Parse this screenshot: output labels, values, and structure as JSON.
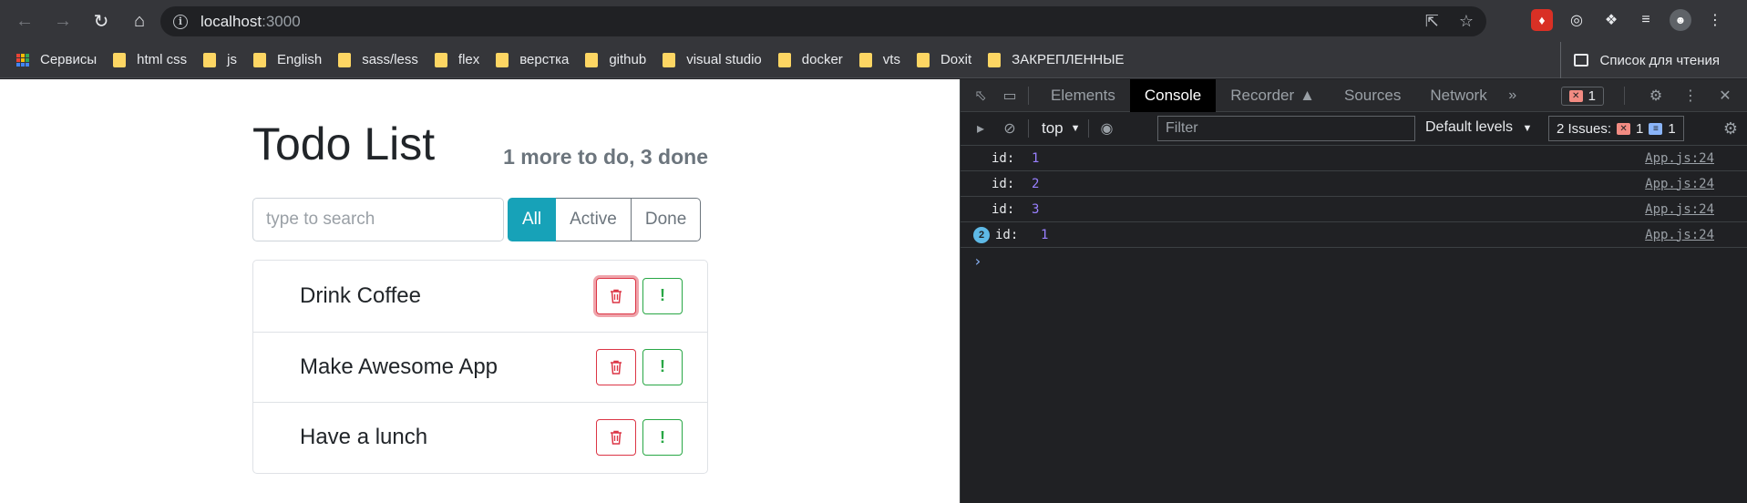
{
  "browser": {
    "url_host": "localhost",
    "url_port": ":3000",
    "bookmarks": [
      {
        "label": "Сервисы",
        "type": "apps"
      },
      {
        "label": "html css",
        "type": "folder"
      },
      {
        "label": "js",
        "type": "folder"
      },
      {
        "label": "English",
        "type": "folder"
      },
      {
        "label": "sass/less",
        "type": "folder"
      },
      {
        "label": "flex",
        "type": "folder"
      },
      {
        "label": "верстка",
        "type": "folder"
      },
      {
        "label": "github",
        "type": "folder"
      },
      {
        "label": "visual studio",
        "type": "folder"
      },
      {
        "label": "docker",
        "type": "folder"
      },
      {
        "label": "vts",
        "type": "folder"
      },
      {
        "label": "Doxit",
        "type": "folder"
      },
      {
        "label": "ЗАКРЕПЛЕННЫЕ",
        "type": "folder"
      }
    ],
    "reading_list": "Список для чтения"
  },
  "app": {
    "title": "Todo List",
    "status": "1 more to do, 3 done",
    "search_placeholder": "type to search",
    "filters": [
      {
        "label": "All",
        "active": true
      },
      {
        "label": "Active",
        "active": false
      },
      {
        "label": "Done",
        "active": false
      }
    ],
    "todos": [
      {
        "label": "Drink Coffee"
      },
      {
        "label": "Make Awesome App"
      },
      {
        "label": "Have a lunch"
      }
    ],
    "colors": {
      "accent": "#17a2b8",
      "danger": "#dc3545",
      "success": "#28a745"
    }
  },
  "devtools": {
    "tabs": [
      "Elements",
      "Console",
      "Recorder",
      "Sources",
      "Network"
    ],
    "active_tab": "Console",
    "error_count": "1",
    "context": "top",
    "filter_placeholder": "Filter",
    "levels": "Default levels",
    "issues_label": "2 Issues:",
    "issues_errors": "1",
    "issues_messages": "1",
    "logs": [
      {
        "key": "id:",
        "value": "1",
        "source": "App.js:24",
        "count": ""
      },
      {
        "key": "id:",
        "value": "2",
        "source": "App.js:24",
        "count": ""
      },
      {
        "key": "id:",
        "value": "3",
        "source": "App.js:24",
        "count": ""
      },
      {
        "key": "id:",
        "value": "1",
        "source": "App.js:24",
        "count": "2"
      }
    ]
  }
}
